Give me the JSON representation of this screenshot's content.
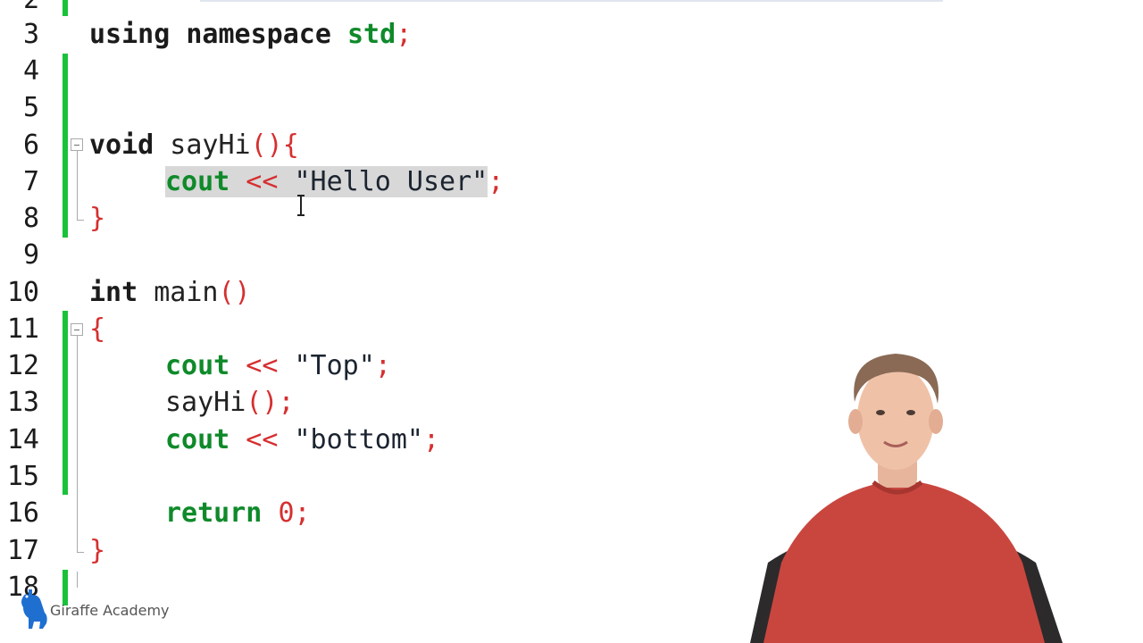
{
  "line_numbers": [
    "2",
    "3",
    "4",
    "5",
    "6",
    "7",
    "8",
    "9",
    "10",
    "11",
    "12",
    "13",
    "14",
    "15",
    "16",
    "17",
    "18"
  ],
  "code": {
    "l3": {
      "kw": "using",
      "mid": " namespace ",
      "name": "std",
      "semi": ";"
    },
    "l6": {
      "type": "void",
      "name": " sayHi",
      "parens": "()",
      "brace": "{"
    },
    "l7": {
      "kw": "cout",
      "op": " << ",
      "str": "\"Hello User\"",
      "semi": ";"
    },
    "l8": {
      "brace": "}"
    },
    "l10": {
      "type": "int",
      "name": " main",
      "parens": "()"
    },
    "l11": {
      "brace": "{"
    },
    "l12": {
      "kw": "cout",
      "op": " << ",
      "str": "\"Top\"",
      "semi": ";"
    },
    "l13": {
      "name": "sayHi",
      "parens": "()",
      "semi": ";"
    },
    "l14": {
      "kw": "cout",
      "op": " << ",
      "str": "\"bottom\"",
      "semi": ";"
    },
    "l16": {
      "kw": "return",
      "num": "0",
      "semi": ";"
    },
    "l17": {
      "brace": "}"
    }
  },
  "watermark": {
    "text": "Giraffe Academy"
  },
  "colors": {
    "change_bar": "#19c239",
    "keyword": "#0f8a2a",
    "punctuation": "#d62f2f",
    "selection": "#d8d8d8",
    "shirt": "#c9463f"
  },
  "icons": [
    "giraffe-logo-icon",
    "fold-collapse-icon",
    "ibeam-cursor-icon"
  ]
}
